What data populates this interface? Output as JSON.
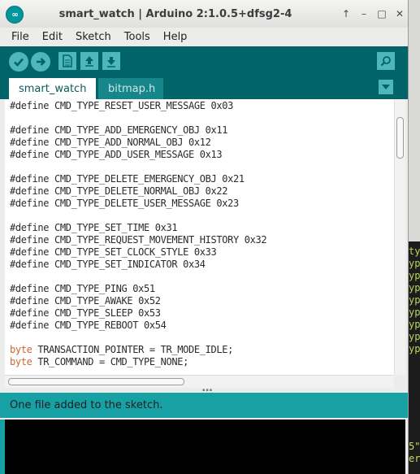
{
  "window": {
    "title": "smart_watch | Arduino 2:1.0.5+dfsg2-4",
    "controls": [
      "↑",
      "–",
      "□",
      "✕"
    ]
  },
  "menu": [
    "File",
    "Edit",
    "Sketch",
    "Tools",
    "Help"
  ],
  "toolbar": {
    "verify_icon": "checkmark-icon",
    "upload_icon": "right-arrow-icon",
    "new_icon": "new-file-icon",
    "open_icon": "open-up-arrow-icon",
    "save_icon": "save-down-arrow-icon",
    "serial_monitor_icon": "magnifier-icon"
  },
  "tabs": [
    {
      "label": "smart_watch",
      "active": true
    },
    {
      "label": "bitmap.h",
      "active": false
    }
  ],
  "code_lines": [
    [
      "",
      "#define CMD_TYPE_RESET_USER_MESSAGE 0x03"
    ],
    [
      "",
      ""
    ],
    [
      "",
      "#define CMD_TYPE_ADD_EMERGENCY_OBJ 0x11"
    ],
    [
      "",
      "#define CMD_TYPE_ADD_NORMAL_OBJ 0x12"
    ],
    [
      "",
      "#define CMD_TYPE_ADD_USER_MESSAGE 0x13"
    ],
    [
      "",
      ""
    ],
    [
      "",
      "#define CMD_TYPE_DELETE_EMERGENCY_OBJ 0x21"
    ],
    [
      "",
      "#define CMD_TYPE_DELETE_NORMAL_OBJ 0x22"
    ],
    [
      "",
      "#define CMD_TYPE_DELETE_USER_MESSAGE 0x23"
    ],
    [
      "",
      ""
    ],
    [
      "",
      "#define CMD_TYPE_SET_TIME 0x31"
    ],
    [
      "",
      "#define CMD_TYPE_REQUEST_MOVEMENT_HISTORY 0x32"
    ],
    [
      "",
      "#define CMD_TYPE_SET_CLOCK_STYLE 0x33"
    ],
    [
      "",
      "#define CMD_TYPE_SET_INDICATOR 0x34"
    ],
    [
      "",
      ""
    ],
    [
      "",
      "#define CMD_TYPE_PING 0x51"
    ],
    [
      "",
      "#define CMD_TYPE_AWAKE 0x52"
    ],
    [
      "",
      "#define CMD_TYPE_SLEEP 0x53"
    ],
    [
      "",
      "#define CMD_TYPE_REBOOT 0x54"
    ],
    [
      "",
      ""
    ],
    [
      "byte",
      " TRANSACTION_POINTER = TR_MODE_IDLE;"
    ],
    [
      "byte",
      " TR_COMMAND = CMD_TYPE_NONE;"
    ]
  ],
  "status_message": "One file added to the sketch.",
  "background_window_lines": [
    "ty",
    "yp",
    "yp",
    "yp",
    "yp",
    "yp",
    "yp",
    "yp",
    "yp"
  ],
  "background_window_bottom_lines": [
    "5\"",
    "er"
  ],
  "colors": {
    "toolbar": "#006468",
    "status": "#17a1a5",
    "keyword": "#cc6633"
  }
}
